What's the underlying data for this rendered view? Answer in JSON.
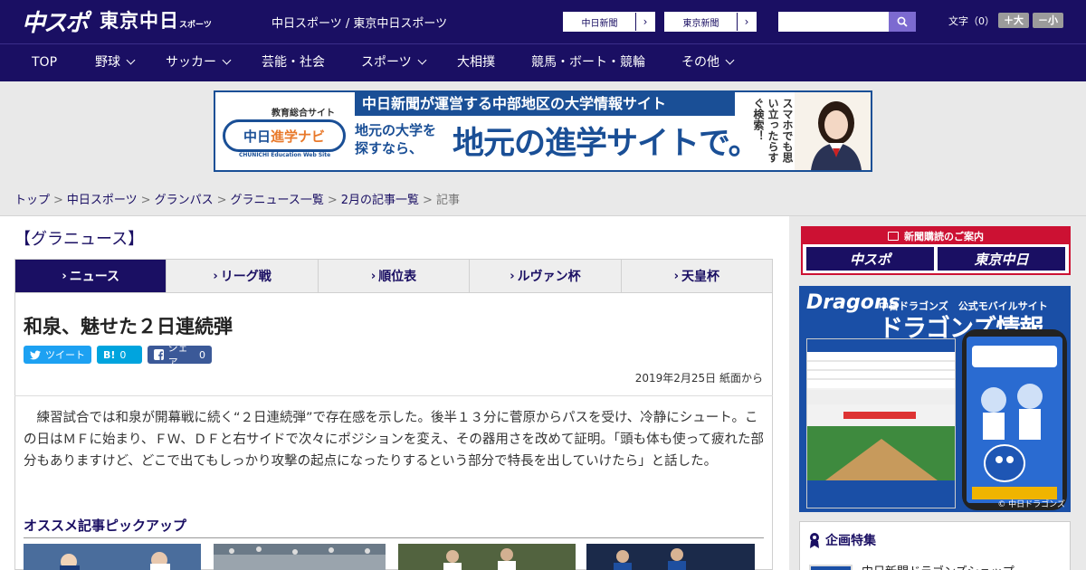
{
  "header": {
    "logo_chuspo": "中スポ",
    "logo_tokyo": "東京中日",
    "logo_tokyo_small": "スポーツ",
    "site_name": "中日スポーツ / 東京中日スポーツ",
    "btn_chunichi": "中日新聞",
    "btn_tokyo": "東京新聞",
    "search_placeholder": "",
    "font_label": "文字（0）",
    "font_large": "＋大",
    "font_small": "－小"
  },
  "menu": [
    {
      "label": "TOP",
      "dropdown": false
    },
    {
      "label": "野球",
      "dropdown": true
    },
    {
      "label": "サッカー",
      "dropdown": true
    },
    {
      "label": "芸能・社会",
      "dropdown": false
    },
    {
      "label": "スポーツ",
      "dropdown": true
    },
    {
      "label": "大相撲",
      "dropdown": false
    },
    {
      "label": "競馬・ボート・競輪",
      "dropdown": false
    },
    {
      "label": "その他",
      "dropdown": true
    }
  ],
  "banner": {
    "tag": "教育総合サイト",
    "logo_a": "中日",
    "logo_b": "進学ナビ",
    "logo_sub": "CHUNICHI Education Web Site",
    "headline": "中日新聞が運営する中部地区の大学情報サイト",
    "small_line1": "地元の大学を",
    "small_line2": "探すなら、",
    "big": "地元の進学サイトで。",
    "vertical": "スマホでも思い立ったらすぐ検索！"
  },
  "breadcrumb": {
    "items": [
      "トップ",
      "中日スポーツ",
      "グランパス",
      "グラニュース一覧",
      "2月の記事一覧"
    ],
    "current": "記事",
    "separator": ">"
  },
  "category": "【グラニュース】",
  "tabs": [
    {
      "label": "ニュース",
      "active": true
    },
    {
      "label": "リーグ戦",
      "active": false
    },
    {
      "label": "順位表",
      "active": false
    },
    {
      "label": "ルヴァン杯",
      "active": false
    },
    {
      "label": "天皇杯",
      "active": false
    }
  ],
  "article": {
    "title": "和泉、魅せた２日連続弾",
    "share": {
      "tweet": "ツイート",
      "hatena_icon": "B!",
      "hatena_count": "0",
      "fb_label": "シェア",
      "fb_count": "0"
    },
    "date": "2019年2月25日 紙面から",
    "body": "練習試合では和泉が開幕戦に続く“２日連続弾”で存在感を示した。後半１３分に菅原からパスを受け、冷静にシュート。この日はＭＦに始まり、ＦＷ、ＤＦと右サイドで次々にポジションを変え、その器用さを改めて証明。「頭も体も使って疲れた部分もありますけど、どこで出てもしっかり攻撃の起点になったりするという部分で特長を出していけたら」と話した。"
  },
  "pickup_title": "オススメ記事ピックアップ",
  "sidebar": {
    "subscribe_head": "新聞購読のご案内",
    "sub_a": "中スポ",
    "sub_b": "東京中日",
    "dragons_logo": "Dragons",
    "dragons_h2": "中日ドラゴンズ　公式モバイルサイト",
    "dragons_h3": "ドラゴンズ情報",
    "dragons_copy": "© 中日ドラゴンズ",
    "kikaku_title": "企画特集",
    "kikaku_item": "中日新聞ドラゴンズショップ"
  },
  "colors": {
    "brand": "#1a0f63",
    "accent_red": "#cc1133",
    "twitter": "#1da1f2",
    "hatena": "#00a4de",
    "facebook": "#3b5998"
  }
}
